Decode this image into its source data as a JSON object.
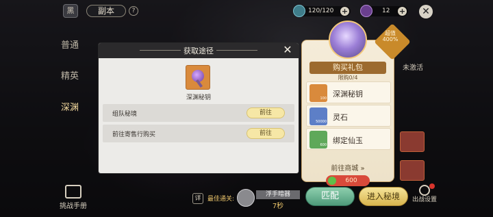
{
  "topbar": {
    "cap_icon": "黑",
    "title": "副本",
    "help": "?",
    "stamina": "120/120",
    "keys": "12",
    "plus": "+",
    "close": "✕"
  },
  "side_tabs": [
    {
      "label": "普通"
    },
    {
      "label": "精英"
    },
    {
      "label": "深渊"
    }
  ],
  "bottom_left": {
    "label": "挑战手册"
  },
  "modal": {
    "title": "获取途径",
    "close": "✕",
    "item_name": "深渊秘钥",
    "routes": [
      {
        "label": "组队秘境",
        "button": "前往"
      },
      {
        "label": "前往寄售行购买",
        "button": "前往"
      }
    ]
  },
  "gift": {
    "discount": "超值 400%",
    "title": "购买礼包",
    "limit": "限购0/4",
    "items": [
      {
        "name": "深渊秘钥",
        "qty": "100"
      },
      {
        "name": "灵石",
        "qty": "50000"
      },
      {
        "name": "绑定仙玉",
        "qty": "600"
      }
    ],
    "shop_link": "前往商城 »",
    "price": "600"
  },
  "right_side": {
    "label": "未激活"
  },
  "bottom": {
    "detail": "详",
    "best": "最佳通关:",
    "player_name": "浮手暗器",
    "player_time": "7秒",
    "match": "匹配",
    "enter": "进入秘境",
    "settings": "出战设置"
  }
}
